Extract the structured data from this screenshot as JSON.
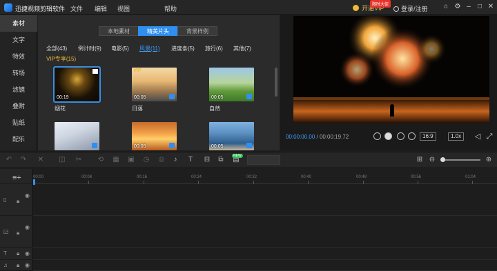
{
  "app": {
    "title": "迅捷视频剪辑软件"
  },
  "menu": {
    "file": "文件",
    "edit": "编辑",
    "view": "视图",
    "help": "帮助"
  },
  "header": {
    "vip_label": "开通VIP",
    "vip_badge": "限时大促",
    "login": "登录/注册"
  },
  "sidebar": {
    "items": [
      "素材",
      "文字",
      "特效",
      "转场",
      "滤镜",
      "叠附",
      "贴纸",
      "配乐"
    ],
    "active": "素材"
  },
  "media": {
    "tabs": [
      "本地素材",
      "精美片头",
      "背景样例"
    ],
    "active_tab": "精美片头",
    "categories": [
      "全部(43)",
      "倒计时(9)",
      "电影(5)",
      "风景(11)",
      "进度条(5)",
      "旅行(6)",
      "其他(7)"
    ],
    "active_category": "风景(11)",
    "section_label": "VIP专享(15)",
    "items": [
      {
        "label": "烟花",
        "duration": "00:19"
      },
      {
        "label": "日落",
        "duration": "00:05"
      },
      {
        "label": "自然",
        "duration": "00:05"
      },
      {
        "label": "",
        "duration": ""
      },
      {
        "label": "",
        "duration": "00:05"
      },
      {
        "label": "",
        "duration": "00:05"
      }
    ],
    "vip_mark": "VIP"
  },
  "preview": {
    "current_time": "00:00:00.00",
    "separator": " / ",
    "total_time": "00:00:19.72",
    "aspect": "16:9",
    "speed": "1.0x"
  },
  "toolbar": {
    "new_badge": "NEW"
  },
  "timeline": {
    "ticks": [
      "00:00",
      "00:08",
      "00:16",
      "00:24",
      "00:32",
      "00:40",
      "00:48",
      "00:56",
      "01:04"
    ]
  },
  "colors": {
    "accent": "#2f8ff0",
    "vip_gold": "#f0b93a"
  }
}
